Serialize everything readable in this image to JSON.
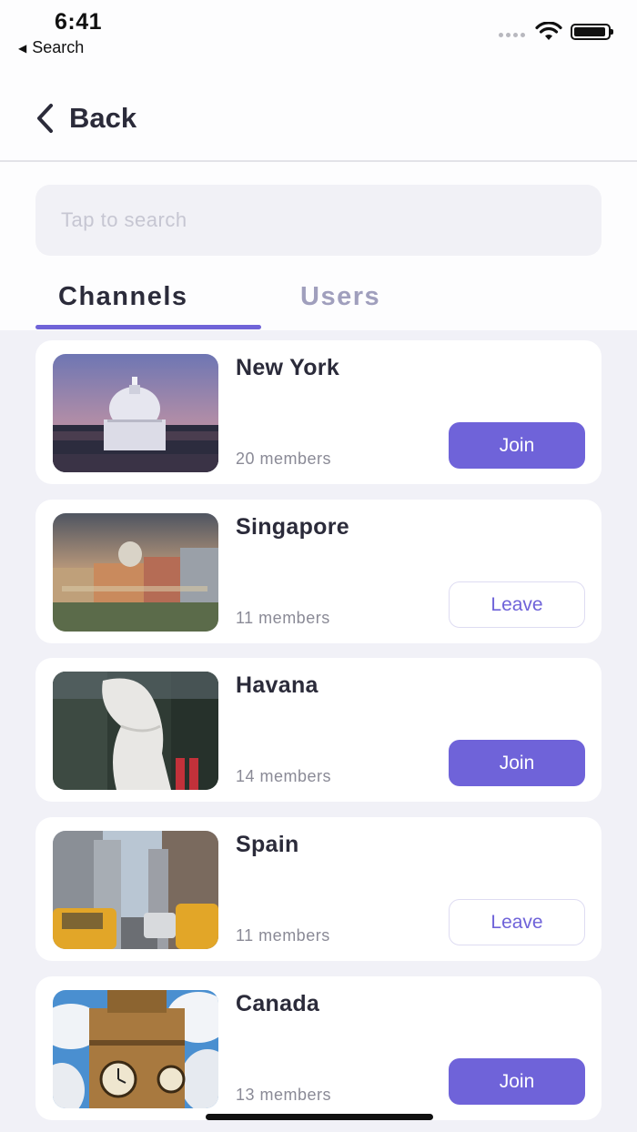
{
  "status_bar": {
    "time": "6:41",
    "back_app": "Search"
  },
  "nav": {
    "back_label": "Back"
  },
  "search": {
    "placeholder": "Tap to search"
  },
  "tabs": [
    {
      "label": "Channels",
      "active": true
    },
    {
      "label": "Users",
      "active": false
    }
  ],
  "channels": [
    {
      "name": "New York",
      "members": "20 members",
      "action": "Join",
      "image": "capitol-dome"
    },
    {
      "name": "Singapore",
      "members": "11 members",
      "action": "Leave",
      "image": "city-dome-buildings"
    },
    {
      "name": "Havana",
      "members": "14 members",
      "action": "Join",
      "image": "merlion-statue"
    },
    {
      "name": "Spain",
      "members": "11 members",
      "action": "Leave",
      "image": "street-taxis"
    },
    {
      "name": "Canada",
      "members": "13 members",
      "action": "Join",
      "image": "clock-tower"
    }
  ],
  "colors": {
    "accent": "#6f63d9",
    "text_dark": "#2b2b3a",
    "text_muted": "#8a8a96",
    "list_bg": "#f1f1f7"
  }
}
